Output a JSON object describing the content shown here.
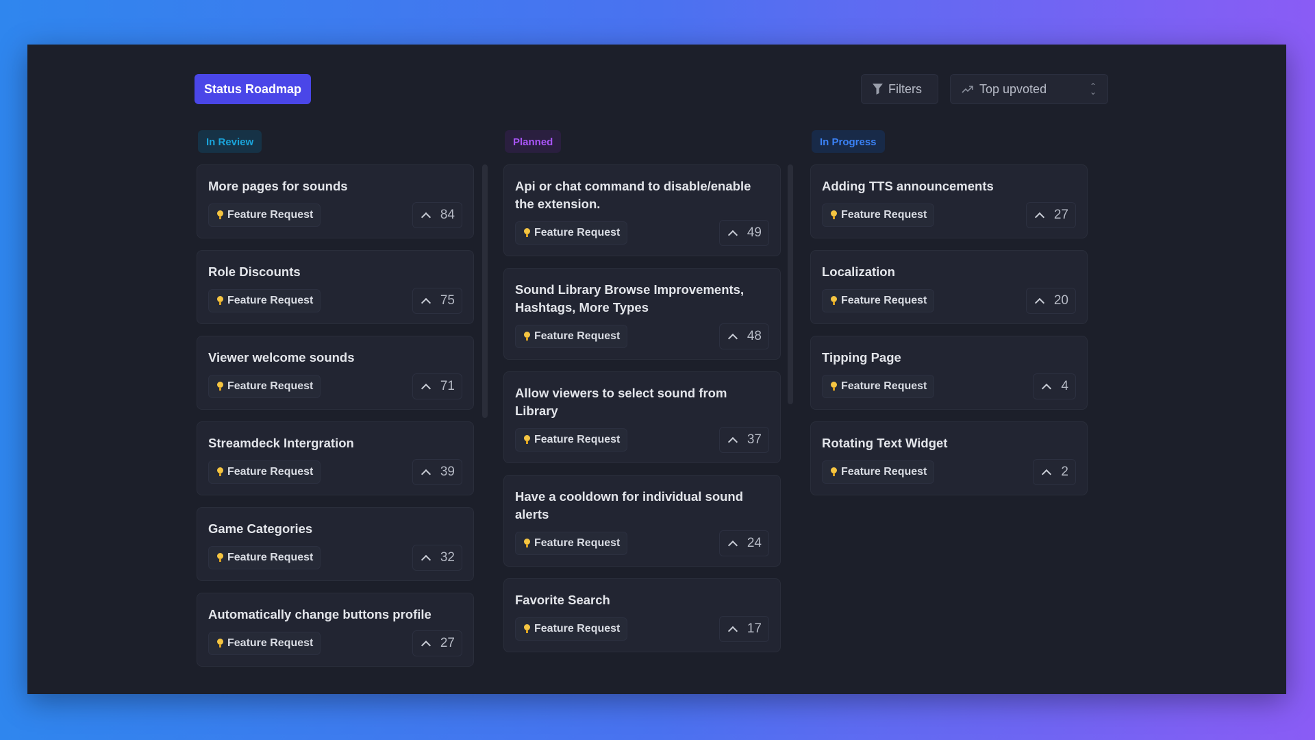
{
  "header": {
    "title": "Status Roadmap",
    "filters_label": "Filters",
    "sort_label": "Top upvoted"
  },
  "colors": {
    "accent": "#4a46e8",
    "in_review": "#1aa3d9",
    "planned": "#a855f7",
    "in_progress": "#3b82f6"
  },
  "columns": [
    {
      "status": "In Review",
      "cards": [
        {
          "title": "More pages for sounds",
          "tag": "Feature Request",
          "votes": "84"
        },
        {
          "title": "Role Discounts",
          "tag": "Feature Request",
          "votes": "75"
        },
        {
          "title": "Viewer welcome sounds",
          "tag": "Feature Request",
          "votes": "71"
        },
        {
          "title": "Streamdeck Intergration",
          "tag": "Feature Request",
          "votes": "39"
        },
        {
          "title": "Game Categories",
          "tag": "Feature Request",
          "votes": "32"
        },
        {
          "title": "Automatically change buttons profile",
          "tag": "Feature Request",
          "votes": "27"
        }
      ]
    },
    {
      "status": "Planned",
      "cards": [
        {
          "title": "Api or chat command to disable/enable the extension.",
          "tag": "Feature Request",
          "votes": "49"
        },
        {
          "title": "Sound Library Browse Improvements, Hashtags, More Types",
          "tag": "Feature Request",
          "votes": "48"
        },
        {
          "title": "Allow viewers to select sound from Library",
          "tag": "Feature Request",
          "votes": "37"
        },
        {
          "title": "Have a cooldown for individual sound alerts",
          "tag": "Feature Request",
          "votes": "24"
        },
        {
          "title": "Favorite Search",
          "tag": "Feature Request",
          "votes": "17"
        }
      ]
    },
    {
      "status": "In Progress",
      "cards": [
        {
          "title": "Adding TTS announcements",
          "tag": "Feature Request",
          "votes": "27"
        },
        {
          "title": "Localization",
          "tag": "Feature Request",
          "votes": "20"
        },
        {
          "title": "Tipping Page",
          "tag": "Feature Request",
          "votes": "4"
        },
        {
          "title": "Rotating Text Widget",
          "tag": "Feature Request",
          "votes": "2"
        }
      ]
    }
  ]
}
